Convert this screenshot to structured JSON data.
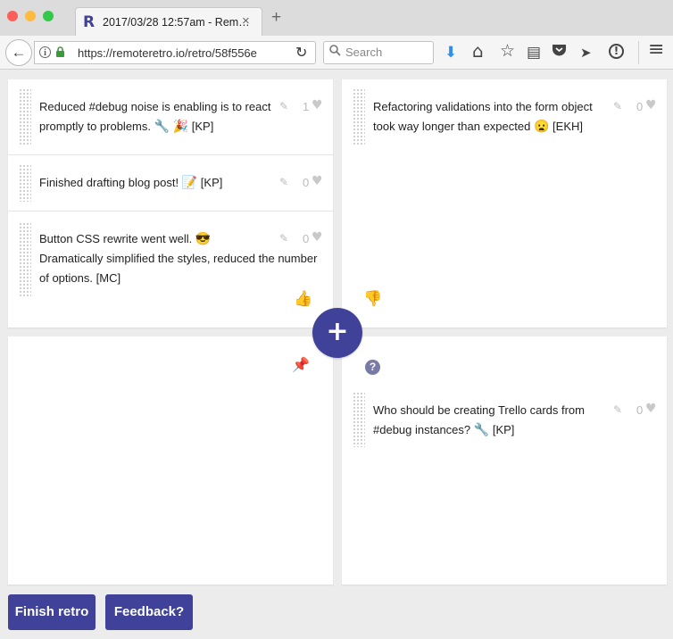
{
  "browser": {
    "tab_title": "2017/03/28 12:57am - Rem…",
    "tab_favicon": "R",
    "url": "https://remoteretro.io/retro/58f556e",
    "search_placeholder": "Search",
    "icons": {
      "close_tab": "×",
      "new_tab": "+",
      "back": "←",
      "reload": "↻",
      "download": "⬇",
      "home": "⌂",
      "bookmark": "☆",
      "reading_list": "▤",
      "pocket": "◡",
      "send": "➤",
      "alert": "!",
      "menu": "≡"
    }
  },
  "retro": {
    "happy": [
      {
        "text": "Reduced #debug noise is enabling is to react promptly to problems.",
        "emoji": [
          "🔧",
          "🎉"
        ],
        "author": "[KP]",
        "votes": "1"
      },
      {
        "text": "Finished drafting blog post!",
        "emoji": [
          "📝"
        ],
        "author": "[KP]",
        "votes": "0"
      },
      {
        "text_line1": "Button CSS rewrite went well.",
        "emoji": [
          "😎"
        ],
        "text_rest": "Dramatically simplified the styles, reduced the number of options.",
        "author": "[MC]",
        "votes": "0"
      }
    ],
    "sad": [
      {
        "text": "Refactoring validations into the form object took way longer than expected",
        "emoji": [
          "😦"
        ],
        "author": "[EKH]",
        "votes": "0"
      }
    ],
    "confused": [
      {
        "text": "Who should be creating Trello cards from #debug instances?",
        "emoji": [
          "🔧"
        ],
        "author": "[KP]",
        "votes": "0"
      }
    ],
    "action_items": []
  },
  "icons": {
    "pencil": "✎",
    "heart": "♥",
    "thumbs_up": "👍",
    "thumbs_down": "👎",
    "pin": "📌",
    "question": "?",
    "add": "+"
  },
  "buttons": {
    "finish": "Finish retro",
    "feedback": "Feedback?"
  },
  "colors": {
    "accent": "#3f4298",
    "happy": "#8fc78f",
    "sad": "#d9415c",
    "pin": "#f3c12f",
    "question": "#7a7aa6"
  }
}
